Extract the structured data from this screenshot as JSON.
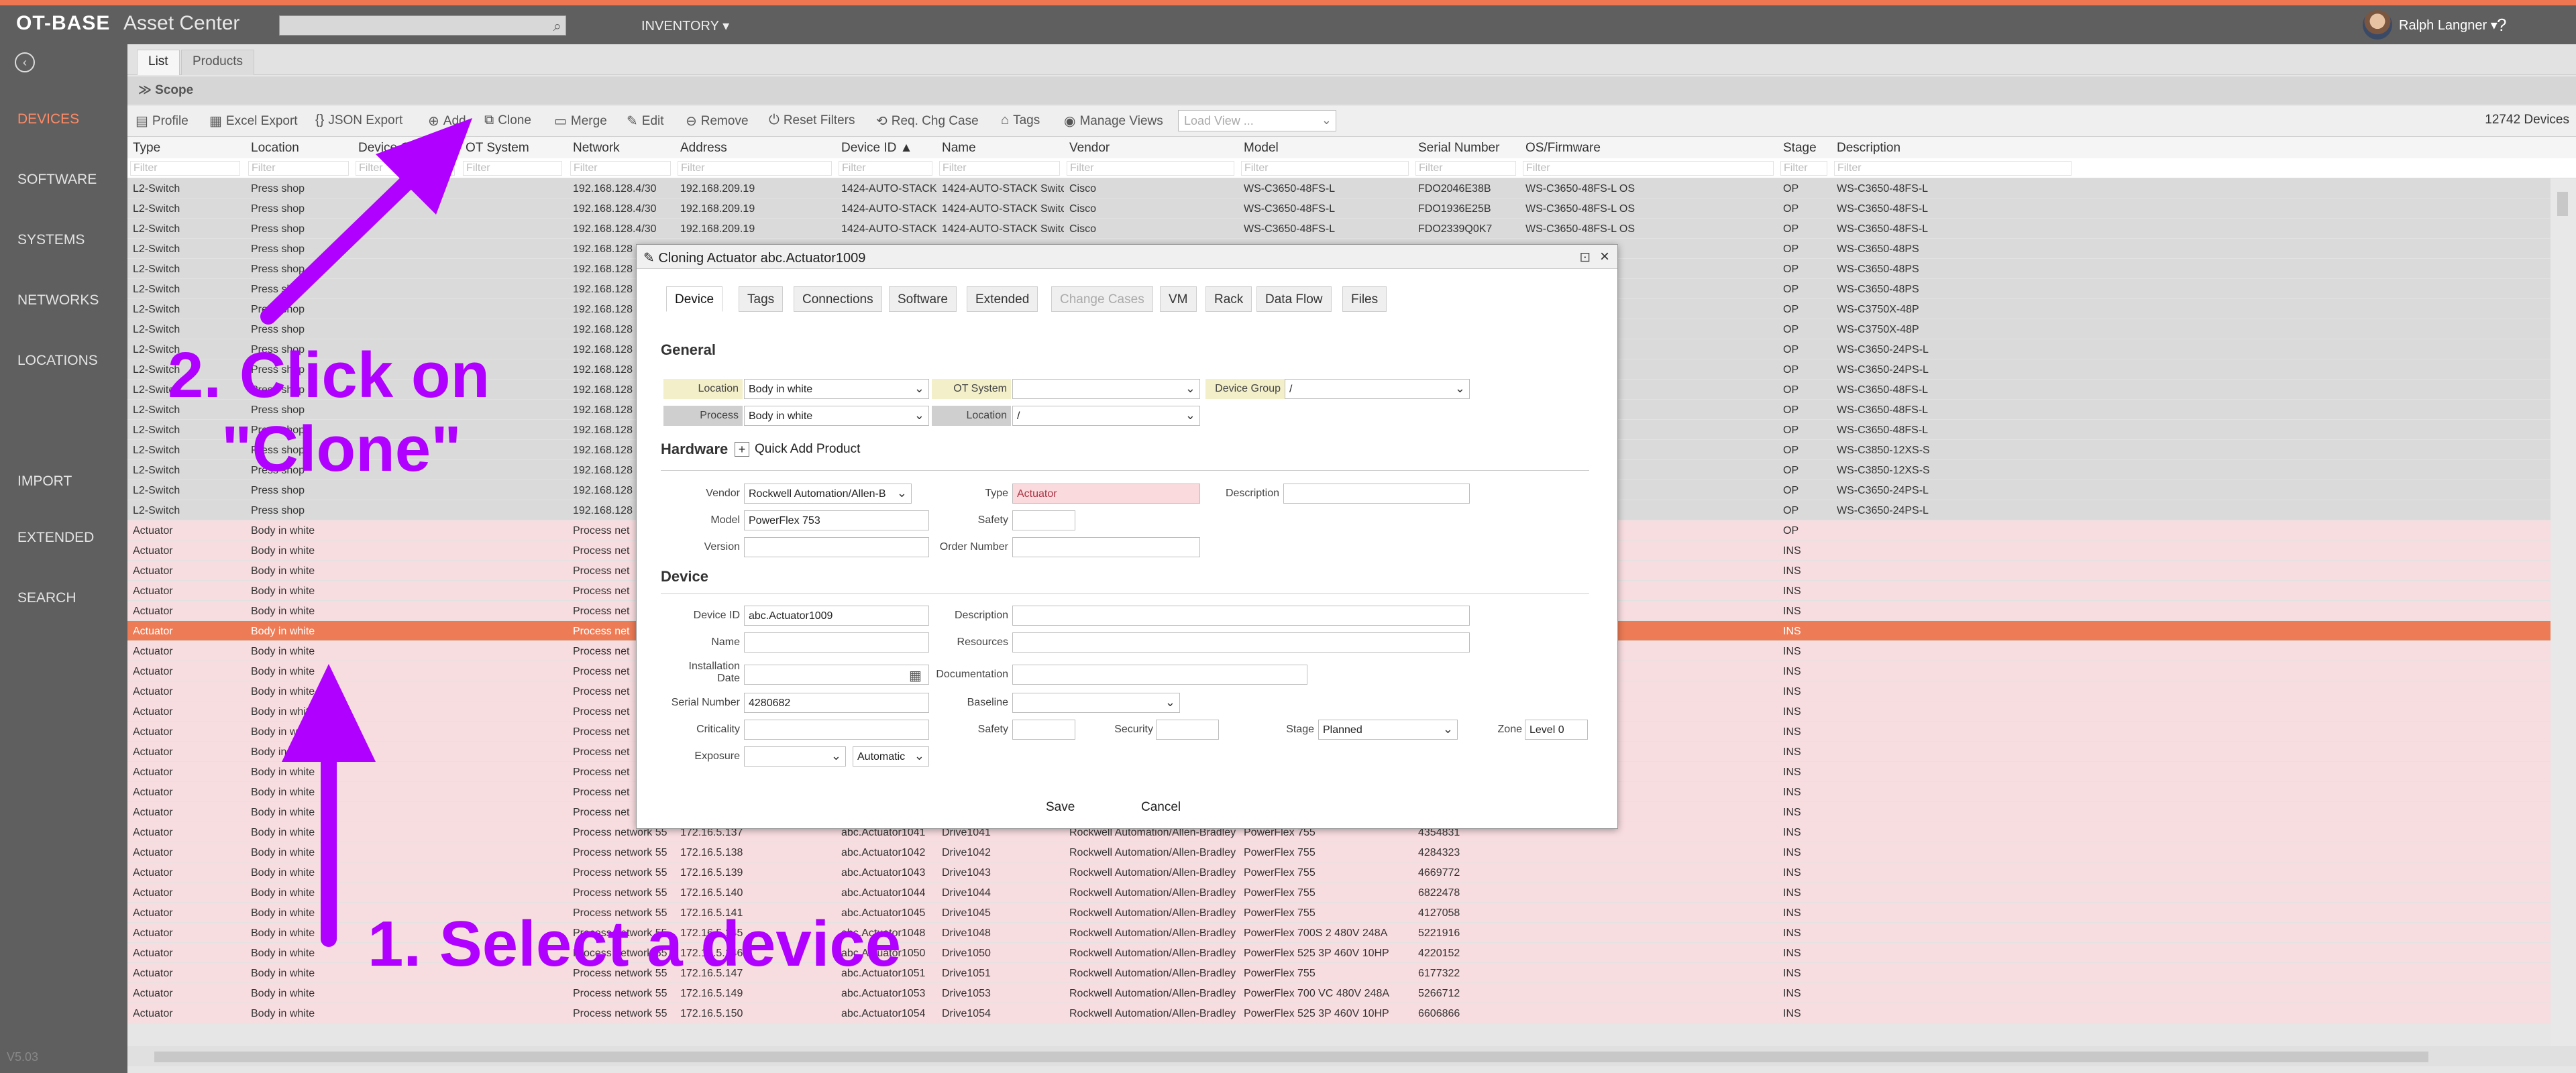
{
  "header": {
    "logo": "OT-BASE",
    "app": "Asset Center",
    "menu": "INVENTORY ▾",
    "user": "Ralph Langner ▾",
    "help": "?"
  },
  "sidebar": {
    "items": [
      "DEVICES",
      "SOFTWARE",
      "SYSTEMS",
      "NETWORKS",
      "LOCATIONS",
      "IMPORT",
      "EXTENDED",
      "SEARCH"
    ],
    "version": "V5.03"
  },
  "tabs": [
    "List",
    "Products"
  ],
  "scope": "Scope",
  "toolbar": {
    "items": [
      "Profile",
      "Excel Export",
      "JSON Export",
      "Add",
      "Clone",
      "Merge",
      "Edit",
      "Remove",
      "Reset Filters",
      "Req. Chg Case",
      "Tags",
      "Manage Views"
    ],
    "load_view_placeholder": "Load View ...",
    "count": "12742 Devices"
  },
  "columns": [
    "Type",
    "Location",
    "Device Gro",
    "OT System",
    "Network",
    "Address",
    "Device ID ▲",
    "Name",
    "Vendor",
    "Model",
    "Serial Number",
    "OS/Firmware",
    "Stage",
    "Description"
  ],
  "filter_placeholder": "Filter",
  "rows": [
    [
      "L2-Switch",
      "Press shop",
      "",
      "",
      "192.168.128.4/30",
      "192.168.209.19",
      "1424-AUTO-STACK",
      "1424-AUTO-STACK Switc",
      "Cisco",
      "WS-C3650-48FS-L",
      "FDO2046E38B",
      "WS-C3650-48FS-L OS",
      "OP",
      "WS-C3650-48FS-L"
    ],
    [
      "L2-Switch",
      "Press shop",
      "",
      "",
      "192.168.128.4/30",
      "192.168.209.19",
      "1424-AUTO-STACK",
      "1424-AUTO-STACK Switc",
      "Cisco",
      "WS-C3650-48FS-L",
      "FDO1936E25B",
      "WS-C3650-48FS-L OS",
      "OP",
      "WS-C3650-48FS-L"
    ],
    [
      "L2-Switch",
      "Press shop",
      "",
      "",
      "192.168.128.4/30",
      "192.168.209.19",
      "1424-AUTO-STACK",
      "1424-AUTO-STACK Switc",
      "Cisco",
      "WS-C3650-48FS-L",
      "FDO2339Q0K7",
      "WS-C3650-48FS-L OS",
      "OP",
      "WS-C3650-48FS-L"
    ],
    [
      "L2-Switch",
      "Press shop",
      "",
      "",
      "192.168.128",
      "",
      "",
      "",
      "",
      "",
      "",
      "OS",
      "OP",
      "WS-C3650-48PS"
    ],
    [
      "L2-Switch",
      "Press shop",
      "",
      "",
      "192.168.128",
      "",
      "",
      "",
      "",
      "",
      "",
      "OS",
      "OP",
      "WS-C3650-48PS"
    ],
    [
      "L2-Switch",
      "Press shop",
      "",
      "",
      "192.168.128",
      "",
      "",
      "",
      "",
      "",
      "",
      "OS",
      "OP",
      "WS-C3650-48PS"
    ],
    [
      "L2-Switch",
      "Press shop",
      "",
      "",
      "192.168.128",
      "",
      "",
      "",
      "",
      "",
      "",
      "OS",
      "OP",
      "WS-C3750X-48P"
    ],
    [
      "L2-Switch",
      "Press shop",
      "",
      "",
      "192.168.128",
      "",
      "",
      "",
      "",
      "",
      "",
      "OS",
      "OP",
      "WS-C3750X-48P"
    ],
    [
      "L2-Switch",
      "Press shop",
      "",
      "",
      "192.168.128",
      "",
      "",
      "",
      "",
      "",
      "",
      "OS",
      "OP",
      "WS-C3650-24PS-L"
    ],
    [
      "L2-Switch",
      "Press shop",
      "",
      "",
      "192.168.128",
      "",
      "",
      "",
      "",
      "",
      "",
      "OS",
      "OP",
      "WS-C3650-24PS-L"
    ],
    [
      "L2-Switch",
      "Press shop",
      "",
      "",
      "192.168.128",
      "",
      "",
      "",
      "",
      "",
      "",
      "OS",
      "OP",
      "WS-C3650-48FS-L"
    ],
    [
      "L2-Switch",
      "Press shop",
      "",
      "",
      "192.168.128",
      "",
      "",
      "",
      "",
      "",
      "",
      "OS",
      "OP",
      "WS-C3650-48FS-L"
    ],
    [
      "L2-Switch",
      "Press shop",
      "",
      "",
      "192.168.128",
      "",
      "",
      "",
      "",
      "",
      "",
      "OS",
      "OP",
      "WS-C3650-48FS-L"
    ],
    [
      "L2-Switch",
      "Press shop",
      "",
      "",
      "192.168.128",
      "",
      "",
      "",
      "",
      "",
      "",
      "OS",
      "OP",
      "WS-C3850-12XS-S"
    ],
    [
      "L2-Switch",
      "Press shop",
      "",
      "",
      "192.168.128",
      "",
      "",
      "",
      "",
      "",
      "",
      "OS",
      "OP",
      "WS-C3850-12XS-S"
    ],
    [
      "L2-Switch",
      "Press shop",
      "",
      "",
      "192.168.128",
      "",
      "",
      "",
      "",
      "",
      "",
      "OS",
      "OP",
      "WS-C3650-24PS-L"
    ],
    [
      "L2-Switch",
      "Press shop",
      "",
      "",
      "192.168.128",
      "",
      "",
      "",
      "",
      "",
      "",
      "OS",
      "OP",
      "WS-C3650-24PS-L"
    ],
    [
      "Actuator",
      "Body in white",
      "",
      "",
      "Process net",
      "",
      "",
      "",
      "",
      "",
      "",
      "",
      "OP",
      ""
    ],
    [
      "Actuator",
      "Body in white",
      "",
      "",
      "Process net",
      "",
      "",
      "",
      "",
      "",
      "",
      "",
      "INS",
      ""
    ],
    [
      "Actuator",
      "Body in white",
      "",
      "",
      "Process net",
      "",
      "",
      "",
      "",
      "",
      "",
      "",
      "INS",
      ""
    ],
    [
      "Actuator",
      "Body in white",
      "",
      "",
      "Process net",
      "",
      "",
      "",
      "",
      "",
      "",
      "",
      "INS",
      ""
    ],
    [
      "Actuator",
      "Body in white",
      "",
      "",
      "Process net",
      "",
      "",
      "",
      "",
      "",
      "",
      "",
      "INS",
      ""
    ],
    [
      "Actuator",
      "Body in white",
      "",
      "",
      "Process net",
      "",
      "",
      "",
      "",
      "",
      "",
      "",
      "INS",
      ""
    ],
    [
      "Actuator",
      "Body in white",
      "",
      "",
      "Process net",
      "",
      "",
      "",
      "",
      "",
      "",
      "",
      "INS",
      ""
    ],
    [
      "Actuator",
      "Body in white",
      "",
      "",
      "Process net",
      "",
      "",
      "",
      "",
      "",
      "",
      "",
      "INS",
      ""
    ],
    [
      "Actuator",
      "Body in white",
      "",
      "",
      "Process net",
      "",
      "",
      "",
      "",
      "",
      "",
      "",
      "INS",
      ""
    ],
    [
      "Actuator",
      "Body in white",
      "",
      "",
      "Process net",
      "",
      "",
      "",
      "",
      "",
      "",
      "",
      "INS",
      ""
    ],
    [
      "Actuator",
      "Body in white",
      "",
      "",
      "Process net",
      "",
      "",
      "",
      "",
      "",
      "",
      "",
      "INS",
      ""
    ],
    [
      "Actuator",
      "Body in white",
      "",
      "",
      "Process net",
      "",
      "",
      "",
      "",
      "",
      "",
      "",
      "INS",
      ""
    ],
    [
      "Actuator",
      "Body in white",
      "",
      "",
      "Process net",
      "",
      "",
      "",
      "",
      "",
      "",
      "",
      "INS",
      ""
    ],
    [
      "Actuator",
      "Body in white",
      "",
      "",
      "Process net",
      "",
      "",
      "",
      "",
      "",
      "",
      "",
      "INS",
      ""
    ],
    [
      "Actuator",
      "Body in white",
      "",
      "",
      "Process net",
      "",
      "",
      "",
      "",
      "",
      "",
      "",
      "INS",
      ""
    ],
    [
      "Actuator",
      "Body in white",
      "",
      "",
      "Process network 55",
      "172.16.5.137",
      "abc.Actuator1041",
      "Drive1041",
      "Rockwell Automation/Allen-Bradley",
      "PowerFlex 755",
      "4354831",
      "",
      "INS",
      ""
    ],
    [
      "Actuator",
      "Body in white",
      "",
      "",
      "Process network 55",
      "172.16.5.138",
      "abc.Actuator1042",
      "Drive1042",
      "Rockwell Automation/Allen-Bradley",
      "PowerFlex 755",
      "4284323",
      "",
      "INS",
      ""
    ],
    [
      "Actuator",
      "Body in white",
      "",
      "",
      "Process network 55",
      "172.16.5.139",
      "abc.Actuator1043",
      "Drive1043",
      "Rockwell Automation/Allen-Bradley",
      "PowerFlex 755",
      "4669772",
      "",
      "INS",
      ""
    ],
    [
      "Actuator",
      "Body in white",
      "",
      "",
      "Process network 55",
      "172.16.5.140",
      "abc.Actuator1044",
      "Drive1044",
      "Rockwell Automation/Allen-Bradley",
      "PowerFlex 755",
      "6822478",
      "",
      "INS",
      ""
    ],
    [
      "Actuator",
      "Body in white",
      "",
      "",
      "Process network 55",
      "172.16.5.141",
      "abc.Actuator1045",
      "Drive1045",
      "Rockwell Automation/Allen-Bradley",
      "PowerFlex 755",
      "4127058",
      "",
      "INS",
      ""
    ],
    [
      "Actuator",
      "Body in white",
      "",
      "",
      "Process network 55",
      "172.16.5.145",
      "abc.Actuator1048",
      "Drive1048",
      "Rockwell Automation/Allen-Bradley",
      "PowerFlex 700S 2 480V 248A",
      "5221916",
      "",
      "INS",
      ""
    ],
    [
      "Actuator",
      "Body in white",
      "",
      "",
      "Process network 55",
      "172.16.5.146",
      "abc.Actuator1050",
      "Drive1050",
      "Rockwell Automation/Allen-Bradley",
      "PowerFlex 525 3P 460V 10HP",
      "4220152",
      "",
      "INS",
      ""
    ],
    [
      "Actuator",
      "Body in white",
      "",
      "",
      "Process network 55",
      "172.16.5.147",
      "abc.Actuator1051",
      "Drive1051",
      "Rockwell Automation/Allen-Bradley",
      "PowerFlex 755",
      "6177322",
      "",
      "INS",
      ""
    ],
    [
      "Actuator",
      "Body in white",
      "",
      "",
      "Process network 55",
      "172.16.5.149",
      "abc.Actuator1053",
      "Drive1053",
      "Rockwell Automation/Allen-Bradley",
      "PowerFlex 700 VC 480V 248A",
      "5266712",
      "",
      "INS",
      ""
    ],
    [
      "Actuator",
      "Body in white",
      "",
      "",
      "Process network 55",
      "172.16.5.150",
      "abc.Actuator1054",
      "Drive1054",
      "Rockwell Automation/Allen-Bradley",
      "PowerFlex 525 3P 460V 10HP",
      "6606866",
      "",
      "INS",
      ""
    ]
  ],
  "dialog": {
    "title": "Cloning Actuator abc.Actuator1009",
    "tabs": [
      "Device",
      "Tags",
      "Connections",
      "Software",
      "Extended",
      "Change Cases",
      "VM",
      "Rack",
      "Data Flow",
      "Files"
    ],
    "general_title": "General",
    "location_label": "Location",
    "location_value": "Body in white",
    "ot_system_label": "OT System",
    "ot_system_value": "",
    "device_group_label": "Device Group",
    "device_group_value": "/",
    "process_label": "Process",
    "process_value": "Body in white",
    "location2_label": "Location",
    "location2_value": "/",
    "hardware_title": "Hardware",
    "quick_add": "Quick Add Product",
    "vendor_label": "Vendor",
    "vendor_value": "Rockwell Automation/Allen-B",
    "type_label": "Type",
    "type_value": "Actuator",
    "hw_description_label": "Description",
    "model_label": "Model",
    "model_value": "PowerFlex 753",
    "safety_label": "Safety",
    "version_label": "Version",
    "order_number_label": "Order Number",
    "device_title": "Device",
    "device_id_label": "Device ID",
    "device_id_value": "abc.Actuator1009",
    "description_label": "Description",
    "name_label": "Name",
    "resources_label": "Resources",
    "installation_label": "Installation Date",
    "documentation_label": "Documentation",
    "serial_label": "Serial Number",
    "serial_value": "4280682",
    "baseline_label": "Baseline",
    "criticality_label": "Criticality",
    "safety2_label": "Safety",
    "security_label": "Security",
    "stage_label": "Stage",
    "stage_value": "Planned",
    "zone_label": "Zone",
    "zone_value": "Level 0",
    "exposure_label": "Exposure",
    "automatic_value": "Automatic",
    "save": "Save",
    "cancel": "Cancel"
  },
  "annotations": {
    "step2_line1": "2. Click on",
    "step2_line2": "\"Clone\"",
    "step1": "1. Select a device"
  },
  "colors": {
    "accent": "#ee7752",
    "selected_row": "#ed7b55",
    "actuator_row": "#f8dde0",
    "switch_row": "#dadada",
    "annotation": "#b000ff"
  }
}
